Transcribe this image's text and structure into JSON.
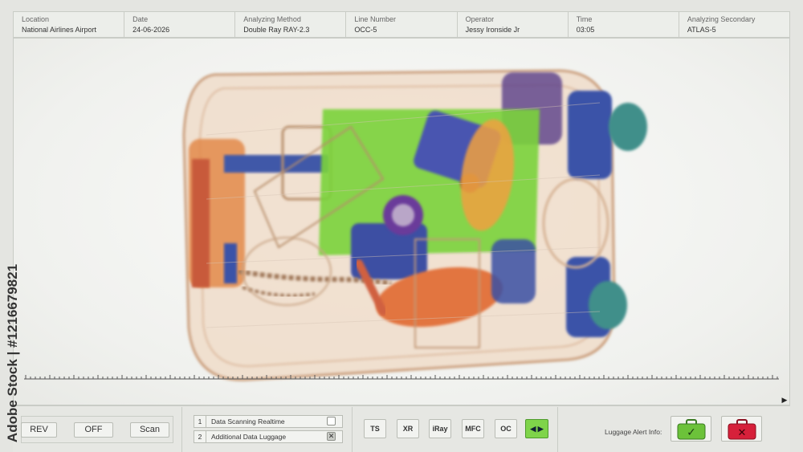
{
  "header": {
    "fields": [
      {
        "label": "Location",
        "value": "National Airlines Airport"
      },
      {
        "label": "Date",
        "value": "24-06-2026"
      },
      {
        "label": "Analyzing Method",
        "value": "Double Ray RAY-2.3"
      },
      {
        "label": "Line Number",
        "value": "OCC-5"
      },
      {
        "label": "Operator",
        "value": "Jessy Ironside Jr"
      },
      {
        "label": "Time",
        "value": "03:05"
      },
      {
        "label": "Analyzing Secondary",
        "value": "ATLAS-5"
      }
    ]
  },
  "controls": {
    "rev_label": "REV",
    "off_label": "OFF",
    "scan_label": "Scan"
  },
  "options": [
    {
      "num": "1",
      "text": "Data Scanning Realtime",
      "checked": false
    },
    {
      "num": "2",
      "text": "Additional Data Luggage",
      "checked": true
    }
  ],
  "modes": {
    "ts": "TS",
    "xr": "XR",
    "iray": "iRay",
    "mfc": "MFC",
    "oc": "OC",
    "toggle_glyph": "◀ ▶"
  },
  "alert": {
    "label": "Luggage Alert Info:",
    "accept_glyph": "✓",
    "reject_glyph": "✕"
  },
  "colors": {
    "accept": "#6cc23a",
    "reject": "#d6203a",
    "active_mode": "#7fd44a"
  },
  "watermark": {
    "side_text": "Adobe Stock | #1216679821"
  }
}
